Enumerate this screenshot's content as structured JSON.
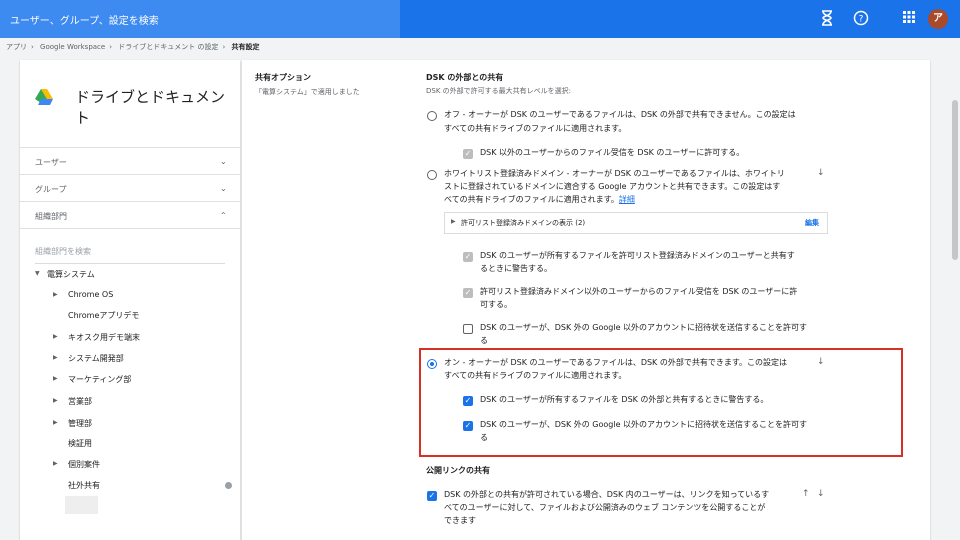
{
  "topbar": {
    "search_placeholder": "ユーザー、グループ、設定を検索",
    "icons": [
      "hourglass-icon",
      "help-icon",
      "apps-grid-icon"
    ],
    "avatar_letter": "ア"
  },
  "breadcrumb": {
    "items": [
      "アプリ",
      "Google Workspace",
      "ドライブとドキュメント の設定",
      "共有設定"
    ]
  },
  "left": {
    "title": "ドライブとドキュメント",
    "sections": [
      "ユーザー",
      "グループ",
      "組織部門"
    ],
    "org_search_placeholder": "組織部門を検索",
    "tree": [
      "電算システム",
      "Chrome OS",
      "Chromeアプリデモ",
      "キオスク用デモ端末",
      "システム開発部",
      "マーケティング部",
      "営業部",
      "管理部",
      "検証用",
      "個別案件",
      "社外共有"
    ]
  },
  "right": {
    "section_title": "共有オプション",
    "section_applied": "「電算システム」で適用しました",
    "heading": "DSK の外部との共有",
    "subheading": "DSK の外部で許可する最大共有レベルを選択:",
    "off_line1": "オフ - オーナーが DSK のユーザーであるファイルは、DSK の外部で共有できません。この設定は",
    "off_line2": "すべての共有ドライブのファイルに適用されます。",
    "off_cb": "DSK 以外のユーザーからのファイル受信を DSK のユーザーに許可する。",
    "wl_line1": "ホワイトリスト登録済みドメイン - オーナーが DSK のユーザーであるファイルは、ホワイトリ",
    "wl_line2": "ストに登録されているドメインに適合する Google アカウントと共有できます。この設定はす",
    "wl_line3": "べての共有ドライブのファイルに適用されます。",
    "wl_link": "詳細",
    "allowlist_label": "許可リスト登録済みドメインの表示 (2)",
    "allowlist_edit": "編集",
    "wl_cb1_line1": "DSK のユーザーが所有するファイルを許可リスト登録済みドメインのユーザーと共有す",
    "wl_cb1_line2": "るときに警告する。",
    "wl_cb2_line1": "許可リスト登録済みドメイン以外のユーザーからのファイル受信を DSK のユーザーに許",
    "wl_cb2_line2": "可する。",
    "wl_cb3_line1": "DSK のユーザーが、DSK 外の Google 以外のアカウントに招待状を送信することを許可す",
    "wl_cb3_line2": "る",
    "on_line1": "オン - オーナーが DSK のユーザーであるファイルは、DSK の外部で共有できます。この設定は",
    "on_line2": "すべての共有ドライブのファイルに適用されます。",
    "on_cb1": "DSK のユーザーが所有するファイルを DSK の外部と共有するときに警告する。",
    "on_cb2_line1": "DSK のユーザーが、DSK 外の Google 以外のアカウントに招待状を送信することを許可す",
    "on_cb2_line2": "る",
    "public_heading": "公開リンクの共有",
    "public_line1": "DSK の外部との共有が許可されている場合、DSK 内のユーザーは、リンクを知っているす",
    "public_line2": "べてのユーザーに対して、ファイルおよび公開済みのウェブ コンテンツを公開することが",
    "public_line3": "できます"
  },
  "colors": {
    "topbar": "#1a73e8",
    "highlight": "#d93025",
    "checkbox": "#1a73e8"
  }
}
